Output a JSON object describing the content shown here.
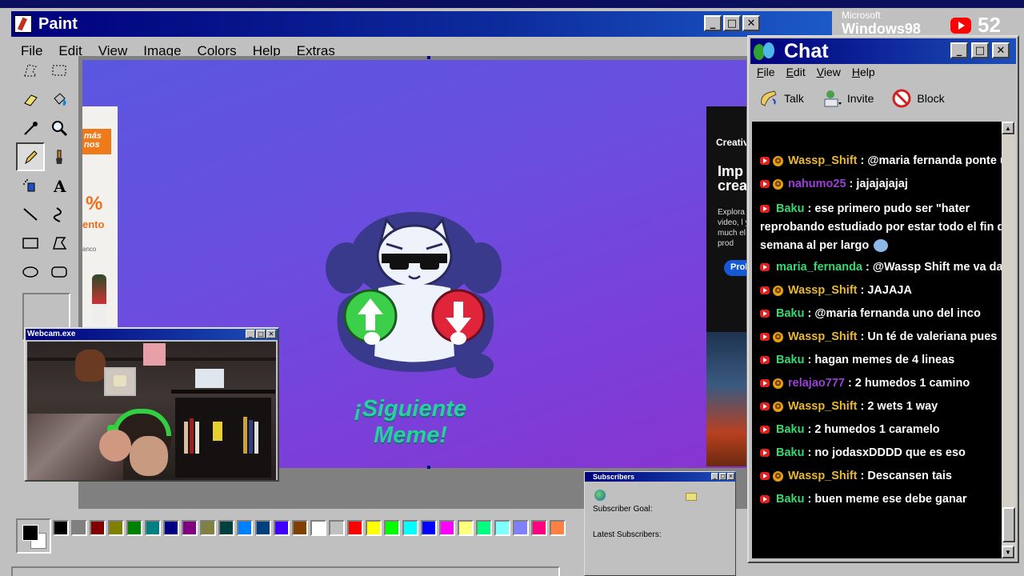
{
  "paint": {
    "title": "Paint",
    "menu": [
      "File",
      "Edit",
      "View",
      "Image",
      "Colors",
      "Help",
      "Extras"
    ],
    "tools": [
      "free-select",
      "rect-select",
      "eraser",
      "fill-bucket",
      "color-picker",
      "magnifier",
      "pencil",
      "brush",
      "airbrush",
      "text",
      "line",
      "curve",
      "rectangle",
      "polygon",
      "ellipse",
      "rounded-rectangle"
    ],
    "active_tool": "pencil",
    "meme_caption": "¡Siguiente Meme!",
    "palette": [
      "#000000",
      "#808080",
      "#800000",
      "#808000",
      "#008000",
      "#008080",
      "#000080",
      "#800080",
      "#808040",
      "#004040",
      "#0080ff",
      "#004080",
      "#4000ff",
      "#804000",
      "#ffffff",
      "#c0c0c0",
      "#ff0000",
      "#ffff00",
      "#00ff00",
      "#00ffff",
      "#0000ff",
      "#ff00ff",
      "#ffff80",
      "#00ff80",
      "#80ffff",
      "#8080ff",
      "#ff0080",
      "#ff8040"
    ],
    "ad_left": {
      "tag": "más nos",
      "pct": "%",
      "word": "ento",
      "small": "anco"
    },
    "ad_right": {
      "t1": "Creativ",
      "t2": "Imp creat",
      "t3": "Explora video, l y much el prod",
      "btn": "Prob"
    }
  },
  "branding": {
    "ms": "Microsoft",
    "win": "Windows98",
    "yt_count": "52"
  },
  "chat": {
    "title": "Chat",
    "menu": [
      "File",
      "Edit",
      "View",
      "Help"
    ],
    "tools": [
      {
        "label": "Talk",
        "icon": "talk-icon"
      },
      {
        "label": "Invite",
        "icon": "invite-icon"
      },
      {
        "label": "Block",
        "icon": "block-icon"
      }
    ],
    "messages": [
      {
        "user": "Wassp_Shift",
        "text": ": @maria fernanda ponte un v",
        "color": "yellow",
        "star": true
      },
      {
        "user": "nahumo25",
        "text": ": jajajajajaj",
        "color": "purple",
        "star": true
      },
      {
        "user": "Baku",
        "text": ": ese primero pudo ser \"hater reprobando estudiado por estar todo el fin de semana al per largo",
        "color": "green",
        "star": false,
        "wrap": true
      },
      {
        "user": "maria_fernanda",
        "text": ": @Wassp Shift me va dar p",
        "color": "green",
        "star": false
      },
      {
        "user": "Wassp_Shift",
        "text": ": JAJAJA",
        "color": "yellow",
        "star": true
      },
      {
        "user": "Baku",
        "text": ": @maria fernanda uno del inco",
        "color": "green",
        "star": false
      },
      {
        "user": "Wassp_Shift",
        "text": ": Un té de valeriana pues",
        "color": "yellow",
        "star": true
      },
      {
        "user": "Baku",
        "text": ": hagan memes de 4 lineas",
        "color": "green",
        "star": false
      },
      {
        "user": "relajao777",
        "text": ": 2 humedos 1 camino",
        "color": "purple",
        "star": true
      },
      {
        "user": "Wassp_Shift",
        "text": ": 2 wets 1 way",
        "color": "yellow",
        "star": true
      },
      {
        "user": "Baku",
        "text": ": 2 humedos 1 caramelo",
        "color": "green",
        "star": false
      },
      {
        "user": "Baku",
        "text": ": no jodasxDDDD que es eso",
        "color": "green",
        "star": false
      },
      {
        "user": "Wassp_Shift",
        "text": ": Descansen tais",
        "color": "yellow",
        "star": true
      },
      {
        "user": "Baku",
        "text": ": buen meme ese debe ganar",
        "color": "green",
        "star": false
      }
    ]
  },
  "webcam": {
    "title": "Webcam.exe"
  },
  "subscribers": {
    "title": "Subscribers",
    "goal_label": "Subscriber Goal:",
    "latest_label": "Latest Subscribers:"
  }
}
